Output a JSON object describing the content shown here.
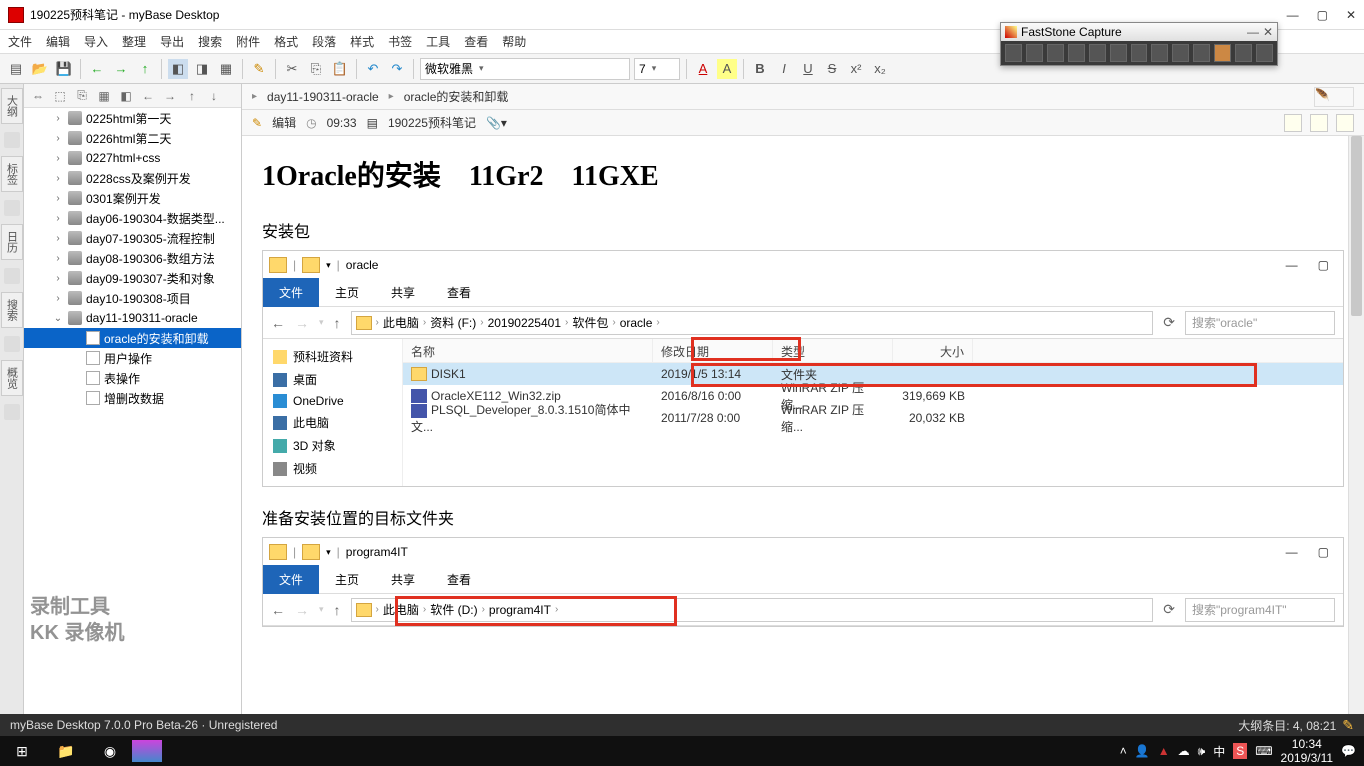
{
  "window": {
    "title": "190225预科笔记 - myBase Desktop"
  },
  "menu": [
    "文件",
    "编辑",
    "导入",
    "整理",
    "导出",
    "搜索",
    "附件",
    "格式",
    "段落",
    "样式",
    "书签",
    "工具",
    "查看",
    "帮助"
  ],
  "toolbar": {
    "font": "微软雅黑",
    "size": "7"
  },
  "tree_toolbar_icons": [
    "⇔",
    "⬚",
    "⎘",
    "▦",
    "◧",
    "←",
    "→",
    "↑",
    "↓"
  ],
  "tree": [
    {
      "l": "0225html第一天",
      "d": 1,
      "t": "db"
    },
    {
      "l": "0226html第二天",
      "d": 1,
      "t": "db"
    },
    {
      "l": "0227html+css",
      "d": 1,
      "t": "db"
    },
    {
      "l": "0228css及案例开发",
      "d": 1,
      "t": "db"
    },
    {
      "l": "0301案例开发",
      "d": 1,
      "t": "db"
    },
    {
      "l": "day06-190304-数据类型...",
      "d": 1,
      "t": "db"
    },
    {
      "l": "day07-190305-流程控制",
      "d": 1,
      "t": "db"
    },
    {
      "l": "day08-190306-数组方法",
      "d": 1,
      "t": "db"
    },
    {
      "l": "day09-190307-类和对象",
      "d": 1,
      "t": "db"
    },
    {
      "l": "day10-190308-项目",
      "d": 1,
      "t": "db"
    },
    {
      "l": "day11-190311-oracle",
      "d": 1,
      "t": "db",
      "open": true
    },
    {
      "l": "oracle的安装和卸载",
      "d": 2,
      "t": "pg",
      "sel": true
    },
    {
      "l": "用户操作",
      "d": 2,
      "t": "pg"
    },
    {
      "l": "表操作",
      "d": 2,
      "t": "pg"
    },
    {
      "l": "增删改数据",
      "d": 2,
      "t": "pg"
    }
  ],
  "sidetabs": [
    "大纲",
    "标签",
    "日历",
    "搜索",
    "概览"
  ],
  "breadcrumb": [
    "day11-190311-oracle",
    "oracle的安装和卸载"
  ],
  "editbar": {
    "edit": "编辑",
    "time": "09:33",
    "note": "190225预科笔记"
  },
  "doc": {
    "h1": "1Oracle的安装    11Gr2    11GXE",
    "s1": "安装包",
    "s2": "准备安装位置的目标文件夹"
  },
  "explorer1": {
    "title": "oracle",
    "tabs": [
      "文件",
      "主页",
      "共享",
      "查看"
    ],
    "path": [
      "此电脑",
      "资料 (F:)",
      "20190225401",
      "软件包",
      "oracle"
    ],
    "search": "搜索\"oracle\"",
    "side": [
      {
        "l": "预科班资料",
        "i": "#ffd86b"
      },
      {
        "l": "桌面",
        "i": "#3a6ea5"
      },
      {
        "l": "OneDrive",
        "i": "#2a8dd4"
      },
      {
        "l": "此电脑",
        "i": "#3a6ea5"
      },
      {
        "l": "3D 对象",
        "i": "#4aa"
      },
      {
        "l": "视频",
        "i": "#888"
      }
    ],
    "cols": [
      "名称",
      "修改日期",
      "类型",
      "大小"
    ],
    "rows": [
      {
        "n": "DISK1",
        "d": "2019/1/5 13:14",
        "t": "文件夹",
        "s": "",
        "f": true,
        "sel": true
      },
      {
        "n": "OracleXE112_Win32.zip",
        "d": "2016/8/16 0:00",
        "t": "WinRAR ZIP 压缩...",
        "s": "319,669 KB",
        "f": false
      },
      {
        "n": "PLSQL_Developer_8.0.3.1510简体中文...",
        "d": "2011/7/28 0:00",
        "t": "WinRAR ZIP 压缩...",
        "s": "20,032 KB",
        "f": false
      }
    ]
  },
  "explorer2": {
    "title": "program4IT",
    "tabs": [
      "文件",
      "主页",
      "共享",
      "查看"
    ],
    "path": [
      "此电脑",
      "软件 (D:)",
      "program4IT"
    ],
    "search": "搜索\"program4IT\""
  },
  "faststone": {
    "title": "FastStone Capture"
  },
  "status": {
    "left": "myBase Desktop 7.0.0 Pro Beta-26 · Unregistered",
    "right": "大纲条目: 4, 08:21"
  },
  "taskbar": {
    "time": "10:34",
    "date": "2019/3/11",
    "ime": "中"
  },
  "watermark": "录制工具\nKK 录像机"
}
